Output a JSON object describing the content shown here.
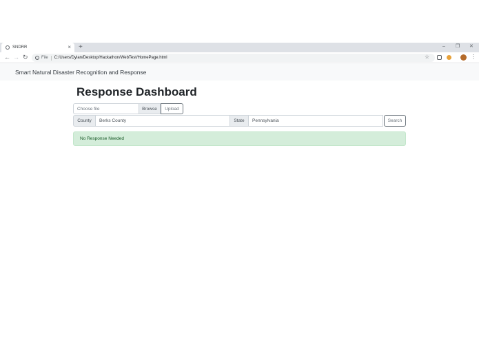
{
  "browser": {
    "tab_title": "SNDRR",
    "tab_close": "×",
    "new_tab": "+",
    "window_controls": [
      "–",
      "❐",
      "✕"
    ],
    "address_scheme": "File",
    "address_url": "C:/Users/Dylan/Desktop/Hackathon/WebTest/HomePage.html",
    "back": "←",
    "forward": "→",
    "reload": "↻",
    "star": "☆",
    "menu": "⋮",
    "info": "i"
  },
  "navbar": {
    "brand": "Smart Natural Disaster Recognition and Response"
  },
  "main": {
    "title": "Response Dashboard",
    "file_placeholder": "Choose file",
    "browse_label": "Browse",
    "upload_label": "Upload",
    "county_label": "County",
    "county_value": "Berks County",
    "state_label": "State",
    "state_value": "Pennsylvania",
    "search_label": "Search",
    "alert_text": "No Response Needed"
  },
  "colors": {
    "alert_bg": "#d4edda",
    "alert_text": "#155724",
    "navbar_bg": "#f8f9fa"
  }
}
